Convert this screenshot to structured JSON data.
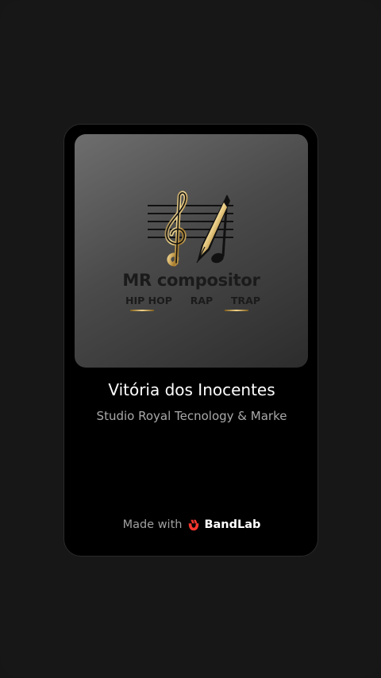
{
  "card": {
    "cover": {
      "logo_title": "MR compositor",
      "genres": [
        "HIP HOP",
        "RAP",
        "TRAP"
      ]
    },
    "track_title": "Vitória dos Inocentes",
    "artist": "Studio Royal Tecnology & Marke",
    "footer": {
      "made_with": "Made with",
      "brand": "BandLab"
    }
  },
  "colors": {
    "background": "#171717",
    "card": "#000000",
    "gold": "#e8c878",
    "brand_red": "#f5362e"
  }
}
